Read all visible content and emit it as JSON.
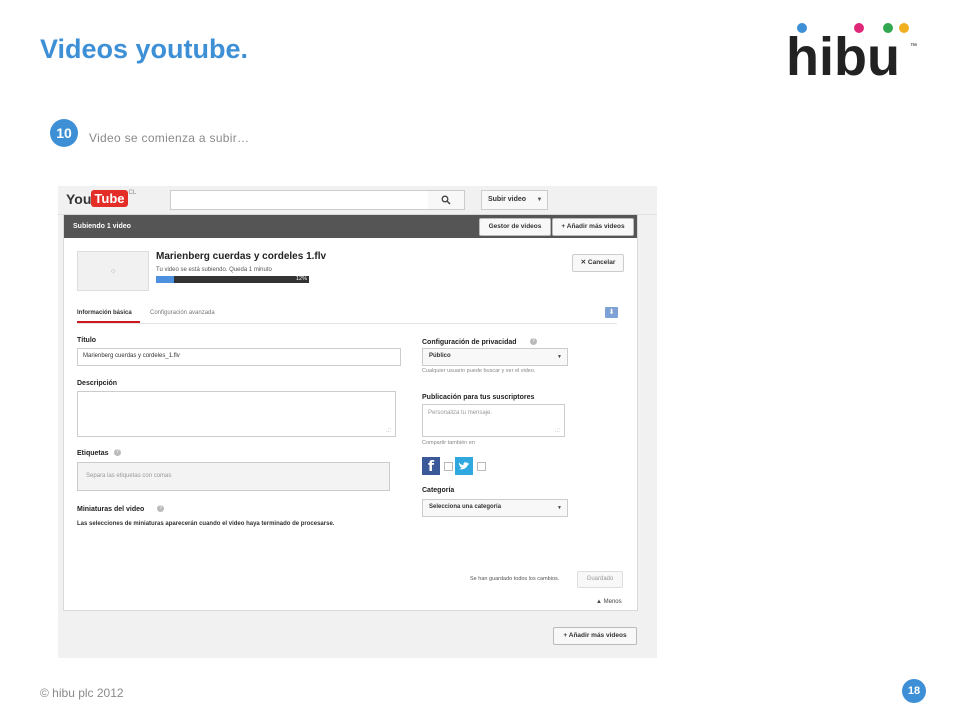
{
  "slide": {
    "title": "Videos youtube.",
    "step_number": "10",
    "step_text": "Video se comienza a subir…",
    "footer": "© hibu plc 2012",
    "page_number": "18",
    "accent_color": "#3d8fd6",
    "logo_text": "hibu",
    "logo_tm": "™"
  },
  "youtube": {
    "logo_you": "You",
    "logo_tube": "Tube",
    "logo_country": "CL",
    "search_icon": "search-icon",
    "search_glyph": "⚲",
    "upload_button": "Subir video",
    "upload_caret": "▼",
    "header": {
      "uploading": "Subiendo 1 video",
      "video_manager": "Gestor de videos",
      "add_more": "+ Añadir más videos"
    },
    "file": {
      "name": "Marienberg cuerdas y cordeles  1.flv",
      "status": "Tu video se está subiendo. Queda 1 minuto",
      "progress_percent": 12,
      "progress_label": "12%",
      "spinner": "⁘"
    },
    "cancel_button": "✕  Cancelar",
    "tabs": {
      "basic": "Información básica",
      "advanced": "Configuración avanzada"
    },
    "download_glyph": "⬇",
    "form": {
      "title_label": "Título",
      "title_value": "Marienberg cuerdas y cordeles_1.flv",
      "description_label": "Descripción",
      "tags_label": "Etiquetas",
      "tags_placeholder": "Separa las etiquetas con comas",
      "thumbnails_label": "Miniaturas del video",
      "thumbnails_message": "Las selecciones de miniaturas aparecerán cuando el video haya terminado de procesarse.",
      "help_glyph": "?",
      "resize_glyph": ".::"
    },
    "privacy": {
      "label": "Configuración de privacidad",
      "value": "Público",
      "hint": "Cualquier usuario puede buscar y ver el video."
    },
    "publication": {
      "label": "Publicación para tus suscriptores",
      "placeholder": "Personaliza tu mensaje.",
      "share_label": "Compartir también en",
      "facebook_glyph": "f",
      "twitter_glyph": "🐦"
    },
    "category": {
      "label": "Categoría",
      "value": "Selecciona una categoría"
    },
    "select_caret": "▼",
    "saved_message": "Se han guardado todos los cambios.",
    "saved_button": "Guardado",
    "less_link": "▲ Menos",
    "add_more_bottom": "+ Añadir más videos"
  }
}
